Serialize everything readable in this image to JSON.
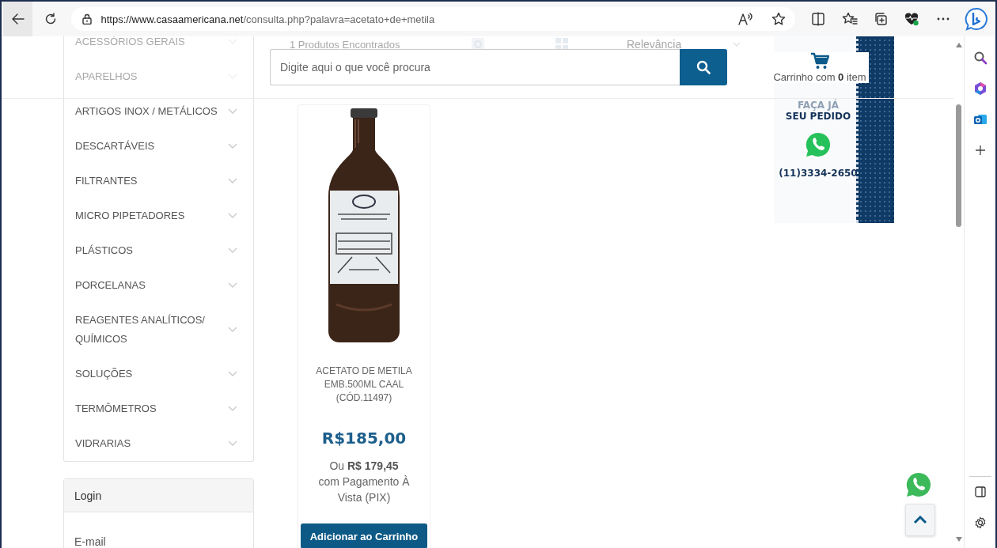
{
  "browser": {
    "url_host": "https://www.casaamericana.net",
    "url_path": "/consulta.php?palavra=acetato+de+metila"
  },
  "header": {
    "search": {
      "placeholder": "Digite aqui o que você procura"
    },
    "cart": "Carrinho com **0** item"
  },
  "sort_bar": {
    "results": "1 Produtos Encontrados",
    "sort": "Relevância"
  },
  "categories": [
    {
      "label": "ACESSÓRIOS GERAIS",
      "faded": true
    },
    {
      "label": "APARELHOS",
      "faded": true
    },
    {
      "label": "ARTIGOS INOX / METÁLICOS",
      "faded": false
    },
    {
      "label": "DESCARTÁVEIS",
      "faded": false
    },
    {
      "label": "FILTRANTES",
      "faded": false
    },
    {
      "label": "MICRO PIPETADORES",
      "faded": false
    },
    {
      "label": "PLÁSTICOS",
      "faded": false
    },
    {
      "label": "PORCELANAS",
      "faded": false
    },
    {
      "label": "REAGENTES ANALÍTICOS/ QUÍMICOS",
      "faded": false
    },
    {
      "label": "SOLUÇÕES",
      "faded": false
    },
    {
      "label": "TERMÔMETROS",
      "faded": false
    },
    {
      "label": "VIDRARIAS",
      "faded": false
    }
  ],
  "login": {
    "title": "Login",
    "email_label": "E-mail"
  },
  "product": {
    "name": "ACETATO DE METILA EMB.500ML CAAL (CÓD.11497)",
    "price": "R$185,00",
    "pix": "Ou **R$ 179,45**\ncom Pagamento À Vista (PIX)",
    "button": "Adicionar ao Carrinho"
  },
  "banner": {
    "line_1": "FAÇA JÁ",
    "line_2": "SEU PEDIDO",
    "phone": "(11)3334-2650"
  }
}
